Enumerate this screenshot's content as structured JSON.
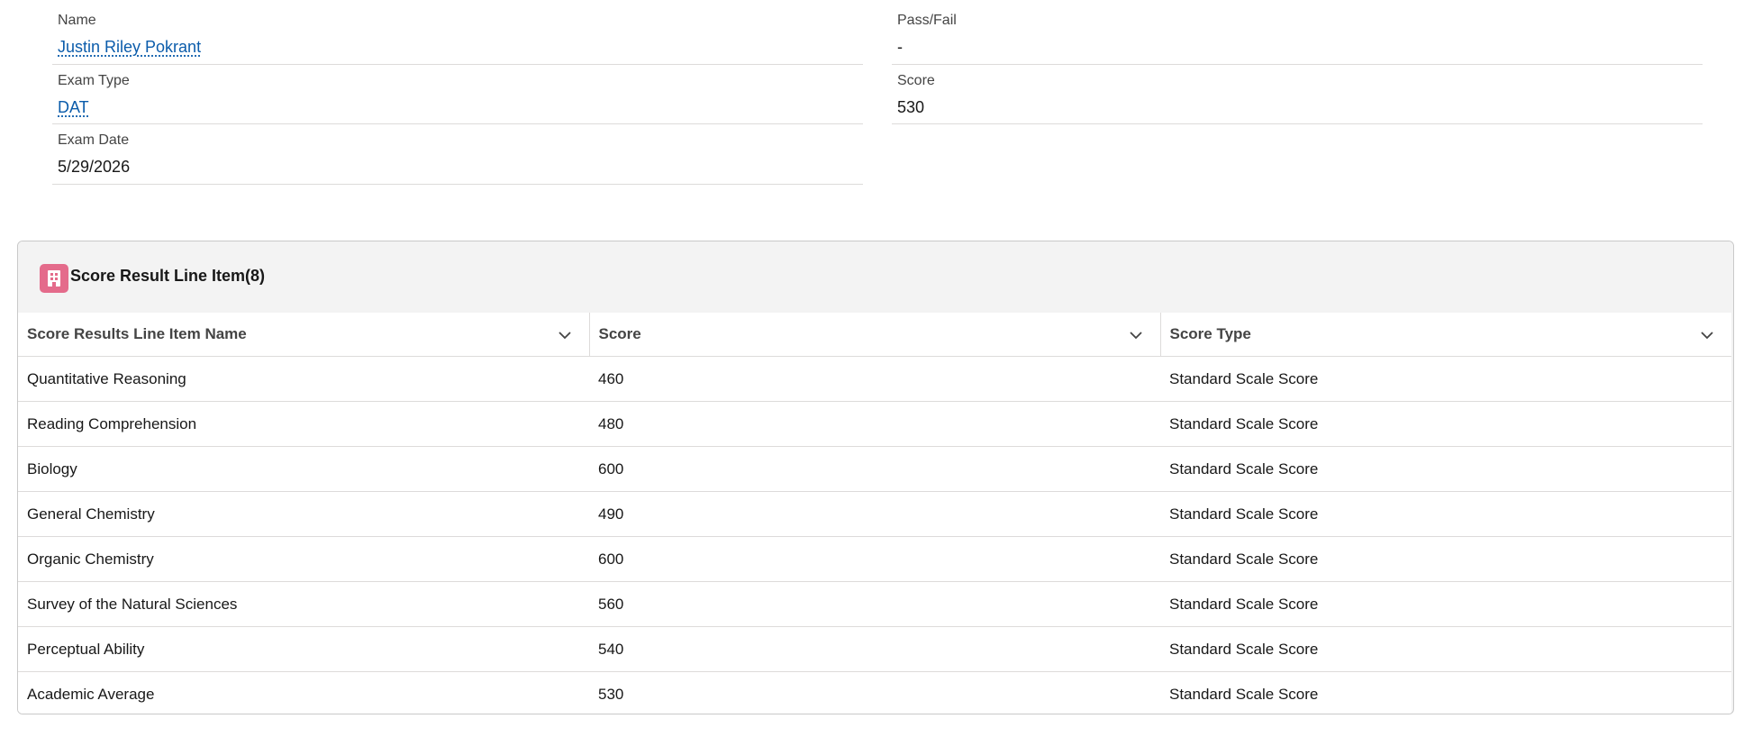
{
  "record": {
    "name_label": "Name",
    "name_value": "Justin Riley Pokrant",
    "exam_type_label": "Exam Type",
    "exam_type_value": "DAT",
    "exam_date_label": "Exam Date",
    "exam_date_value": "5/29/2026",
    "pass_fail_label": "Pass/Fail",
    "pass_fail_value": "-",
    "score_label": "Score",
    "score_value": "530"
  },
  "related_list": {
    "title": "Score Result Line Item(8)",
    "icon": "building-icon",
    "icon_color": "#e46b8b",
    "columns": [
      "Score Results Line Item Name",
      "Score",
      "Score Type"
    ],
    "rows": [
      {
        "name": "Quantitative Reasoning",
        "score": "460",
        "type": "Standard Scale Score"
      },
      {
        "name": "Reading Comprehension",
        "score": "480",
        "type": "Standard Scale Score"
      },
      {
        "name": "Biology",
        "score": "600",
        "type": "Standard Scale Score"
      },
      {
        "name": "General Chemistry",
        "score": "490",
        "type": "Standard Scale Score"
      },
      {
        "name": "Organic Chemistry",
        "score": "600",
        "type": "Standard Scale Score"
      },
      {
        "name": "Survey of the Natural Sciences",
        "score": "560",
        "type": "Standard Scale Score"
      },
      {
        "name": "Perceptual Ability",
        "score": "540",
        "type": "Standard Scale Score"
      },
      {
        "name": "Academic Average",
        "score": "530",
        "type": "Standard Scale Score"
      }
    ]
  },
  "colors": {
    "link": "#0b5cab",
    "header_bg": "#f3f3f3",
    "border": "#dddbda"
  }
}
